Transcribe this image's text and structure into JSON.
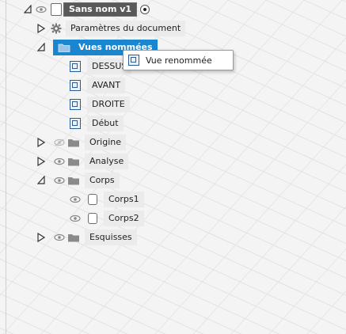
{
  "tree": {
    "root": {
      "name": "Sans nom v1"
    },
    "settings": {
      "label": "Paramètres du document"
    },
    "named_views": {
      "label": "Vues nommées",
      "items": [
        "DESSUS",
        "AVANT",
        "DROITE",
        "Début"
      ]
    },
    "origin": {
      "label": "Origine"
    },
    "analysis": {
      "label": "Analyse"
    },
    "bodies": {
      "label": "Corps",
      "items": [
        "Corps1",
        "Corps2"
      ]
    },
    "sketches": {
      "label": "Esquisses"
    }
  },
  "popup": {
    "label": "Vue renommée"
  },
  "colors": {
    "selection": "#1a86cf",
    "view_icon": "#2b5c9a",
    "name_box": "#595959"
  }
}
